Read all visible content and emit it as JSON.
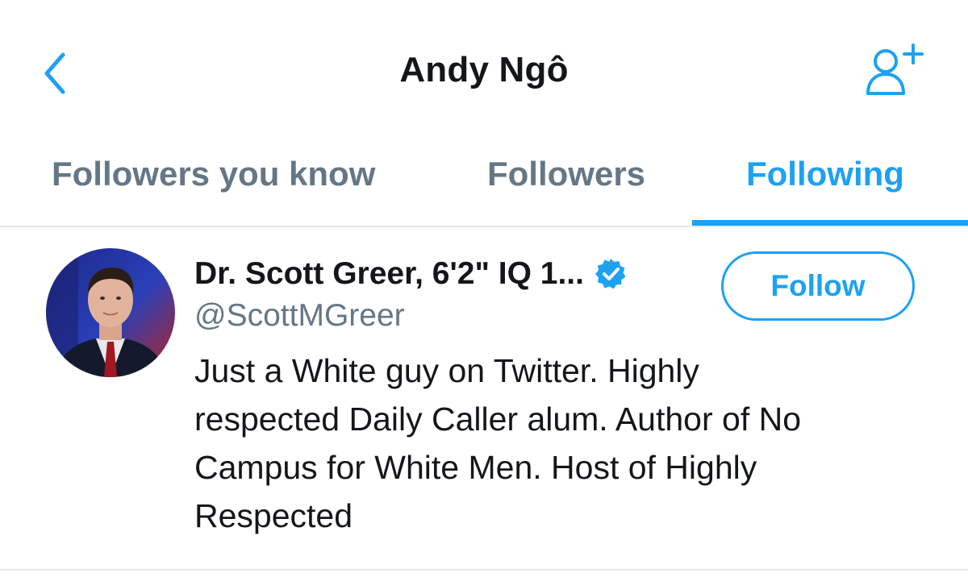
{
  "nav": {
    "title": "Andy Ngô",
    "back_icon": "chevron-left-icon",
    "add_user_icon": "add-user-icon"
  },
  "tabs": [
    {
      "label": "Followers you know",
      "selected": false
    },
    {
      "label": "Followers",
      "selected": false
    },
    {
      "label": "Following",
      "selected": true
    }
  ],
  "user": {
    "name": "Dr. Scott Greer, 6'2\" IQ 1...",
    "verified": true,
    "handle": "@ScottMGreer",
    "bio_lines": [
      "Just a White guy on Twitter. Highly",
      "respected Daily Caller alum. Author of No",
      "Campus for White Men. Host of Highly",
      "Respected"
    ],
    "follow_label": "Follow"
  },
  "colors": {
    "accent": "#1da1f2",
    "text_primary": "#14171a",
    "text_secondary": "#657786",
    "divider": "#e1e8ed"
  }
}
